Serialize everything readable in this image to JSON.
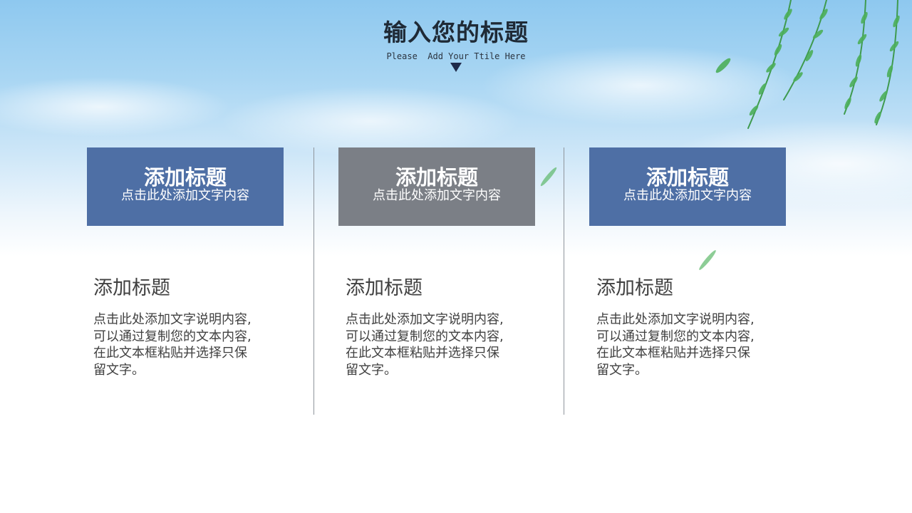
{
  "header": {
    "title": "输入您的标题",
    "subtitle": "Please  Add Your Ttile Here"
  },
  "colors": {
    "card_blue": "#4e6fa5",
    "card_gray": "#7b7f86",
    "divider": "#8f959c",
    "body_text": "#404040",
    "leaf_green": "#3e9a4e"
  },
  "cards": [
    {
      "title": "添加标题",
      "desc": "点击此处添加文字内容",
      "color": "#4e6fa5"
    },
    {
      "title": "添加标题",
      "desc": "点击此处添加文字内容",
      "color": "#7b7f86"
    },
    {
      "title": "添加标题",
      "desc": "点击此处添加文字内容",
      "color": "#4e6fa5"
    }
  ],
  "columns": [
    {
      "heading": "添加标题",
      "text": "点击此处添加文字说明内容,\n可以通过复制您的文本内容,\n在此文本框粘贴并选择只保\n留文字。"
    },
    {
      "heading": "添加标题",
      "text": "点击此处添加文字说明内容,\n可以通过复制您的文本内容,\n在此文本框粘贴并选择只保\n留文字。"
    },
    {
      "heading": "添加标题",
      "text": "点击此处添加文字说明内容,\n可以通过复制您的文本内容,\n在此文本框粘贴并选择只保\n留文字。"
    }
  ],
  "decor": {
    "triangle_icon": "down-triangle-icon",
    "willow_icon": "willow-branch-icon",
    "leaf_icon": "leaf-icon"
  }
}
